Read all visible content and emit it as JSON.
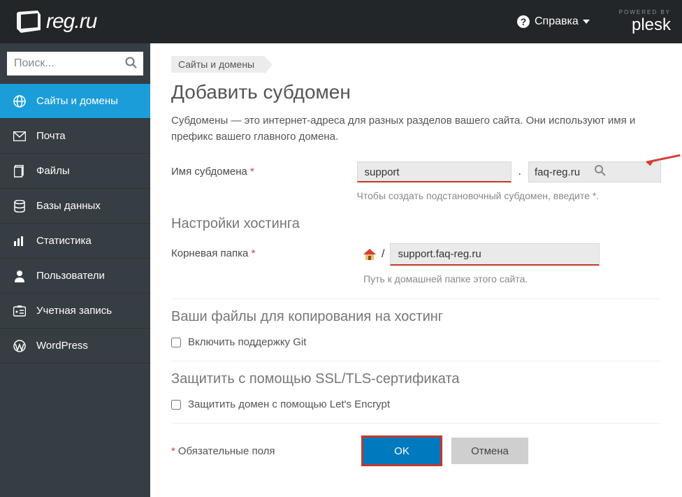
{
  "header": {
    "logo_text": "reg.ru",
    "help_label": "Справка",
    "powered_small": "POWERED BY",
    "powered_brand": "plesk"
  },
  "sidebar": {
    "search_placeholder": "Поиск...",
    "items": [
      {
        "label": "Сайты и домены",
        "icon": "globe"
      },
      {
        "label": "Почта",
        "icon": "mail"
      },
      {
        "label": "Файлы",
        "icon": "files"
      },
      {
        "label": "Базы данных",
        "icon": "database"
      },
      {
        "label": "Статистика",
        "icon": "stats"
      },
      {
        "label": "Пользователи",
        "icon": "user"
      },
      {
        "label": "Учетная запись",
        "icon": "account"
      },
      {
        "label": "WordPress",
        "icon": "wordpress"
      }
    ]
  },
  "main": {
    "breadcrumb": "Сайты и домены",
    "title": "Добавить субдомен",
    "intro": "Субдомены — это интернет-адреса для разных разделов вашего сайта. Они используют имя и префикс вашего главного домена.",
    "subdomain_label": "Имя субдомена",
    "subdomain_value": "support",
    "domain_value": "faq-reg.ru",
    "subdomain_hint": "Чтобы создать подстановочный субдомен, введите *.",
    "section_hosting": "Настройки хостинга",
    "root_label": "Корневая папка",
    "root_value": "support.faq-reg.ru",
    "root_hint": "Путь к домашней папке этого сайта.",
    "section_files": "Ваши файлы для копирования на хостинг",
    "git_label": "Включить поддержку Git",
    "section_ssl": "Защитить с помощью SSL/TLS-сертификата",
    "le_label": "Защитить домен с помощью Let's Encrypt",
    "required_note": "Обязательные поля",
    "ok_label": "OK",
    "cancel_label": "Отмена"
  }
}
